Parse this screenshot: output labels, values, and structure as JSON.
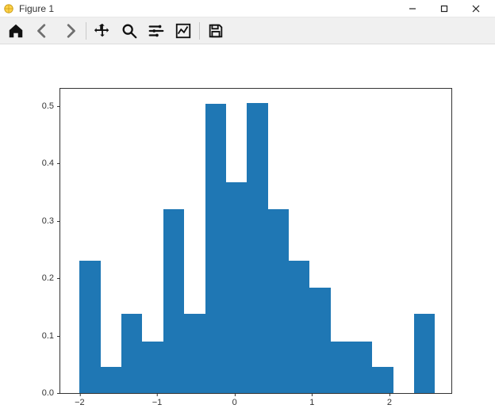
{
  "window": {
    "title": "Figure 1",
    "controls": {
      "min": "–",
      "max": "▢",
      "close": "✕"
    }
  },
  "toolbar": {
    "home": "Home",
    "back": "Back",
    "forward": "Forward",
    "pan": "Pan",
    "zoom": "Zoom",
    "subplots": "Configure subplots",
    "edit": "Edit axis",
    "save": "Save"
  },
  "chart_data": {
    "type": "bar",
    "bin_width": 0.27,
    "x_start": -2.0,
    "bins": [
      {
        "x0": -2.0,
        "x1": -1.73,
        "y": 0.23
      },
      {
        "x0": -1.73,
        "x1": -1.46,
        "y": 0.045
      },
      {
        "x0": -1.46,
        "x1": -1.19,
        "y": 0.138
      },
      {
        "x0": -1.19,
        "x1": -0.92,
        "y": 0.09
      },
      {
        "x0": -0.92,
        "x1": -0.65,
        "y": 0.32
      },
      {
        "x0": -0.65,
        "x1": -0.38,
        "y": 0.138
      },
      {
        "x0": -0.38,
        "x1": -0.11,
        "y": 0.504
      },
      {
        "x0": -0.11,
        "x1": 0.16,
        "y": 0.367
      },
      {
        "x0": 0.16,
        "x1": 0.43,
        "y": 0.505
      },
      {
        "x0": 0.43,
        "x1": 0.7,
        "y": 0.32
      },
      {
        "x0": 0.7,
        "x1": 0.97,
        "y": 0.23
      },
      {
        "x0": 0.97,
        "x1": 1.24,
        "y": 0.184
      },
      {
        "x0": 1.24,
        "x1": 1.51,
        "y": 0.09
      },
      {
        "x0": 1.51,
        "x1": 1.78,
        "y": 0.09
      },
      {
        "x0": 1.78,
        "x1": 2.05,
        "y": 0.045
      },
      {
        "x0": 2.05,
        "x1": 2.32,
        "y": 0.0
      },
      {
        "x0": 2.32,
        "x1": 2.59,
        "y": 0.138
      }
    ],
    "xlim": [
      -2.25,
      2.8
    ],
    "ylim": [
      0.0,
      0.53
    ],
    "xticks": [
      -2,
      -1,
      0,
      1,
      2
    ],
    "yticks": [
      0.0,
      0.1,
      0.2,
      0.3,
      0.4,
      0.5
    ],
    "xlabel": "",
    "ylabel": "",
    "title": "",
    "bar_color": "#1f77b4"
  }
}
